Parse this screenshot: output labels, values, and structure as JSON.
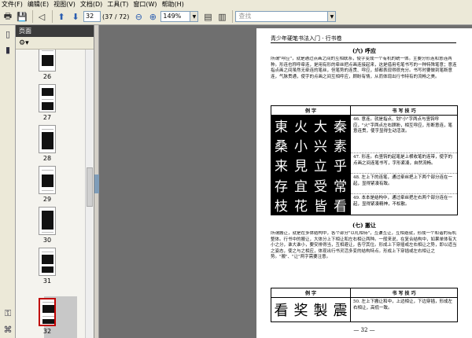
{
  "menu": [
    "文件(F)",
    "编辑(E)",
    "视图(V)",
    "文档(D)",
    "工具(T)",
    "窗口(W)",
    "帮助(H)"
  ],
  "toolbar": {
    "page_value": "32",
    "page_count": "(37 / 72)",
    "zoom_value": "149%",
    "search_placeholder": "查找"
  },
  "panel": {
    "title": "页面",
    "thumb_labels": [
      "26",
      "27",
      "28",
      "29",
      "30",
      "31",
      "32"
    ],
    "selected": "32"
  },
  "page": {
    "running_head": "青少年硬笔书法入门 · 行书卷",
    "section6_title": "(六) 呼应",
    "section6_text": "所谓\"呼应\"，就是通过点画之间的互相联系，使字变成一个有机的统一体。主要分形连和意连两种。形连也称呼牵连，是用有形的牵丝把点画连接起来，这是借用毛笔书写的一种特殊笔意；意连指点画之间虽然无牵连的笔丝，但笔势的连贯、呼应，却都表现得很充分。书写时要做到笔断意连，气脉贯通，使字的点画之间互相呼应，顾盼有情，从而体现出行书特有的流畅之美。",
    "table1_head_left": "例 字",
    "table1_head_right": "书 写 技 巧",
    "table1_chars": [
      "東",
      "火",
      "大",
      "秦",
      "桑",
      "小",
      "兴",
      "素",
      "来",
      "見",
      "立",
      "乎",
      "存",
      "宜",
      "受",
      "常",
      "枝",
      "花",
      "皆",
      "看"
    ],
    "table1_notes": [
      "46. 意连。就是指点、划\"小\"字两点与竖钩呼应，\"火\"字两点左右顾盼，相互呼应，形断意连，笔意连贯，使字显得生动活泼。",
      "47. 形连。右竖钩的起笔是上横收笔的连带，使字的点画之间连笔书写，字形紧凑，自然流畅。",
      "48. 左上下的连笔，通过牵丝把上下两个部分连在一起，显得紧凑有致。",
      "49. 本本是结构中，通过牵丝把左右两个部分连在一起，显得紧凑精神，不松散。"
    ],
    "section7_title": "(七) 搬让",
    "section7_text": "所谓搬让，就是在多体结构中，各个部分\"以礼相待\"，互谦互让，互相避就，形成一个和谐的有机整体。行书中的搬让，大体分上下相让和左右相让两种。一般来说，在复合结构中，如果单体有大小之分，谁大谁小，要安排得当，互相避让，各守其位。形成上下穿插或左右相让之势，即以适当之姿态，使之与之相应，体现出行书灵活多变的结构特点。形成上下穿插或左右相让之势。\"搬\"、\"让\"两字需要注意。",
    "table2_head_left": "例 字",
    "table2_head_right": "书 写 技 巧",
    "table2_chars": [
      "看",
      "奖",
      "製",
      "震"
    ],
    "table2_note": "50. 左上下搬让和中，上边相让，下边穿插，形成左右相让，高低一致。",
    "page_number": "— 32 —"
  }
}
